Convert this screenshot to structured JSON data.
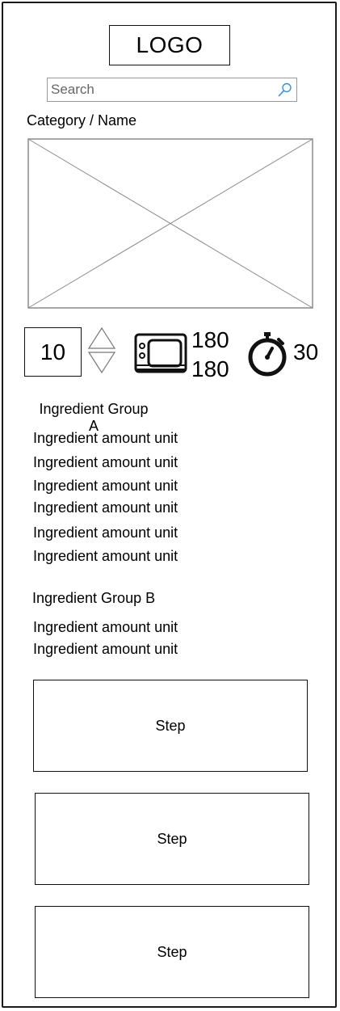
{
  "header": {
    "logo_text": "LOGO"
  },
  "search": {
    "placeholder": "Search",
    "icon": "search-icon"
  },
  "recipe": {
    "category_name": "Category / Name",
    "image_icon": "image-placeholder"
  },
  "controls": {
    "servings": "10",
    "stepper_icons": [
      "chevron-up-icon",
      "chevron-down-icon"
    ],
    "oven_icon": "oven-icon",
    "temperatures": [
      "180",
      "180"
    ],
    "timer_icon": "stopwatch-icon",
    "time": "30"
  },
  "ingredients": {
    "group_a": {
      "title": "Ingredient Group A",
      "items": [
        "Ingredient amount unit",
        "Ingredient amount unit",
        "Ingredient amount unit",
        "Ingredient amount unit",
        "Ingredient amount unit",
        "Ingredient amount unit"
      ]
    },
    "group_b": {
      "title": "Ingredient Group B",
      "items": [
        "Ingredient amount unit",
        "Ingredient amount unit"
      ]
    }
  },
  "steps": [
    "Step",
    "Step",
    "Step"
  ]
}
